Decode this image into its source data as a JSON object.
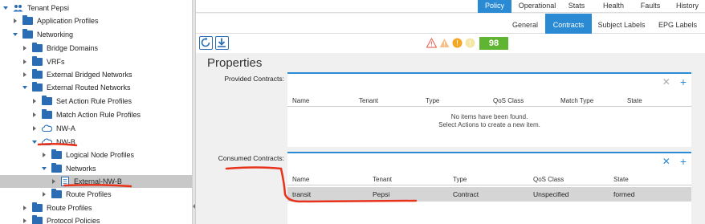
{
  "tree": {
    "items": [
      {
        "label": "Tenant Pepsi",
        "indent": 0,
        "caret": "down",
        "icon": "tenant-icon"
      },
      {
        "label": "Application Profiles",
        "indent": 1,
        "caret": "right",
        "icon": "folder-icon"
      },
      {
        "label": "Networking",
        "indent": 1,
        "caret": "down",
        "icon": "folder-icon"
      },
      {
        "label": "Bridge Domains",
        "indent": 2,
        "caret": "right",
        "icon": "folder-icon"
      },
      {
        "label": "VRFs",
        "indent": 2,
        "caret": "right",
        "icon": "folder-icon"
      },
      {
        "label": "External Bridged Networks",
        "indent": 2,
        "caret": "right",
        "icon": "folder-icon"
      },
      {
        "label": "External Routed Networks",
        "indent": 2,
        "caret": "down",
        "icon": "folder-icon"
      },
      {
        "label": "Set Action Rule Profiles",
        "indent": 3,
        "caret": "right",
        "icon": "folder-icon"
      },
      {
        "label": "Match Action Rule Profiles",
        "indent": 3,
        "caret": "right",
        "icon": "folder-icon"
      },
      {
        "label": "NW-A",
        "indent": 3,
        "caret": "right",
        "icon": "cloud-icon"
      },
      {
        "label": "NW-B",
        "indent": 3,
        "caret": "down",
        "icon": "cloud-icon"
      },
      {
        "label": "Logical Node Profiles",
        "indent": 4,
        "caret": "right",
        "icon": "folder-icon"
      },
      {
        "label": "Networks",
        "indent": 4,
        "caret": "down",
        "icon": "folder-icon"
      },
      {
        "label": "External-NW-B",
        "indent": 5,
        "caret": "right",
        "icon": "document-icon",
        "selected": true
      },
      {
        "label": "Route Profiles",
        "indent": 4,
        "caret": "right",
        "icon": "folder-icon"
      },
      {
        "label": "Route Profiles",
        "indent": 2,
        "caret": "right",
        "icon": "folder-icon"
      },
      {
        "label": "Protocol Policies",
        "indent": 2,
        "caret": "right",
        "icon": "folder-icon"
      }
    ]
  },
  "top_tabs": [
    {
      "label": "Policy",
      "active": true
    },
    {
      "label": "Operational"
    },
    {
      "label": "Stats"
    },
    {
      "label": "Health"
    },
    {
      "label": "Faults"
    },
    {
      "label": "History"
    }
  ],
  "sub_tabs": [
    {
      "label": "General"
    },
    {
      "label": "Contracts",
      "active": true
    },
    {
      "label": "Subject Labels"
    },
    {
      "label": "EPG Labels"
    }
  ],
  "toolbar": {
    "refresh_icon": "refresh-icon",
    "download_icon": "download-icon",
    "fault_icons": [
      "critical-fault-icon",
      "major-fault-icon",
      "minor-fault-icon",
      "warning-fault-icon"
    ],
    "health_score": "98"
  },
  "properties": {
    "title": "Properties",
    "provided": {
      "label": "Provided Contracts:",
      "columns": [
        "Name",
        "Tenant",
        "Type",
        "QoS Class",
        "Match Type",
        "State"
      ],
      "empty_line1": "No items have been found.",
      "empty_line2": "Select Actions to create a new item."
    },
    "consumed": {
      "label": "Consumed Contracts:",
      "columns": [
        "Name",
        "Tenant",
        "Type",
        "QoS Class",
        "State"
      ],
      "rows": [
        {
          "name": "transit",
          "tenant": "Pepsi",
          "type": "Contract",
          "qos": "Unspecified",
          "state": "formed"
        }
      ]
    }
  },
  "colors": {
    "accent": "#2a8ad4",
    "health_green": "#5fb531",
    "annotation_red": "#e8321c"
  }
}
